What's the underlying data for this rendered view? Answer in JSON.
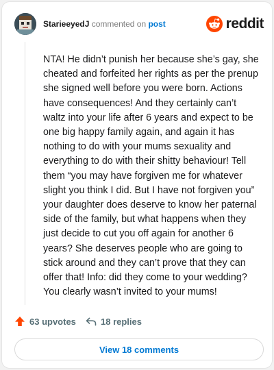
{
  "header": {
    "username": "StarieeyedJ",
    "commented_text": "commented on",
    "post_link": "post",
    "brand": "reddit"
  },
  "comment": {
    "text": "NTA! He didn’t punish her because she’s gay, she cheated and forfeited her rights as per the prenup she signed well before you were born. Actions have consequences! And they certainly can’t waltz into your life after 6 years and expect to be one big happy family again, and again it has nothing to do with your mums sexuality and everything to do with their shitty behaviour! Tell them “you may have forgiven me for whatever slight you think I did. But I have not forgiven you” your daughter does deserve to know her paternal side of the family, but what happens when they just decide to cut you off again for another 6 years? She deserves people who are going to stick around and they can’t prove that they can offer that! Info: did they come to your wedding? You clearly wasn’t invited to your mums!"
  },
  "actions": {
    "upvotes": "63 upvotes",
    "replies": "18 replies",
    "upvote_icon": "upvote-arrow",
    "reply_icon": "reply-arrow"
  },
  "view_comments": "View 18 comments",
  "colors": {
    "brand": "#ff4500",
    "link": "#0079d3",
    "meta": "#576f76"
  }
}
